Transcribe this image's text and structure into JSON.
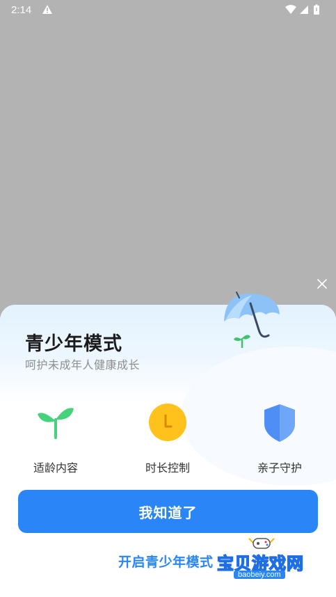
{
  "status_bar": {
    "time": "2:14"
  },
  "sheet": {
    "title": "青少年模式",
    "subtitle": "呵护未成年人健康成长",
    "features": [
      {
        "label": "适龄内容",
        "icon": "sprout-icon"
      },
      {
        "label": "时长控制",
        "icon": "clock-icon"
      },
      {
        "label": "亲子守护",
        "icon": "shield-icon"
      }
    ],
    "primary_button": "我知道了",
    "open_link": "开启青少年模式",
    "colors": {
      "accent": "#2a86f6",
      "sprout": "#45d27a",
      "clock": "#ffc21c",
      "shield": "#4f8ff5"
    }
  },
  "watermark": {
    "text": "宝贝游戏网",
    "url": "baobeiy.com"
  }
}
